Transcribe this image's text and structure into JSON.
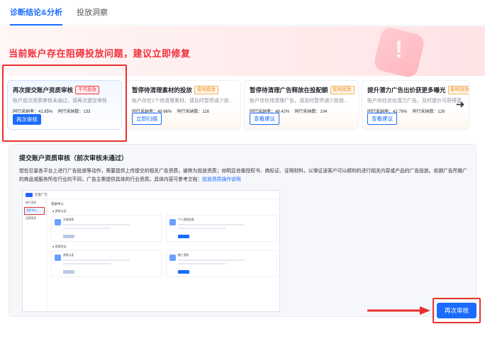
{
  "tabs": [
    {
      "label": "诊断结论&分析",
      "active": true
    },
    {
      "label": "投放洞察",
      "active": false
    }
  ],
  "banner": {
    "title": "当前账户存在阻碍投放问题，建议立即修复",
    "badge_glyph": "!"
  },
  "cards": [
    {
      "title": "再次提交账户资质审核",
      "tag": "不可投放",
      "tag_color": "#f0303a",
      "desc": "账户前次资质审核未通过，请再次提交审核",
      "metric1": "同行采纳率：41.65%",
      "metric2": "同行采纳数：133",
      "button": "再次审核"
    },
    {
      "title": "暂停待清理素材的投放",
      "tag": "影响投放",
      "tag_color": "#f08a17",
      "desc": "账户存在1个待清理素材，请及时暂停减少投...",
      "metric1": "同行采纳率：49.66%",
      "metric2": "同行采纳数：116",
      "button": "立即扫描"
    },
    {
      "title": "暂停待清理广告释放在投配额",
      "tag": "影响投放",
      "tag_color": "#f08a17",
      "desc": "账户存在待清理广告，请及时暂停减少投放...",
      "metric1": "同行采纳率：48.42%",
      "metric2": "同行采纳数：104",
      "button": "查看建议"
    },
    {
      "title": "提升潜力广告出价获更多曝光",
      "tag": "影响投放",
      "tag_color": "#f08a17",
      "desc": "账户存在优化潜力广告，及时提价可获得更...",
      "metric1": "同行采纳率：42.76%",
      "metric2": "同行采纳数：126",
      "button": "查看建议"
    }
  ],
  "next_icon": "arrow-right-icon",
  "detail": {
    "title": "提交账户资质审核（前次审核未通过）",
    "text": "想在巨量各平台上进行广告投放等动作，需要提供上传提交的相关广告资质，被称为投放资质；如明显肖像授权书、商标证、证明材料，以保证该客户可以顺利的进行相关内容或产品的广告投放。依据广告所推广的商品或服务所在行业的不同，广告主需提供具体的行业资质。具体内容可参考文档：",
    "link": "投放资质操作说明"
  },
  "mini_screenshot": {
    "brand": "巨量广告",
    "head": "资质中心",
    "side_items": [
      "账户资质",
      "资质中心",
      "品牌资质"
    ],
    "section1": "● 资质认证",
    "section2": "● 资质验证",
    "card1": "主体资质",
    "card2": "个人资质信息",
    "card3": "资质认证",
    "card4": "推广资质"
  },
  "footer": {
    "button": "再次审核"
  },
  "colors": {
    "primary": "#1b6bff",
    "danger": "#f0303a",
    "warning": "#f08a17",
    "annotation_red": "#e8312f"
  }
}
